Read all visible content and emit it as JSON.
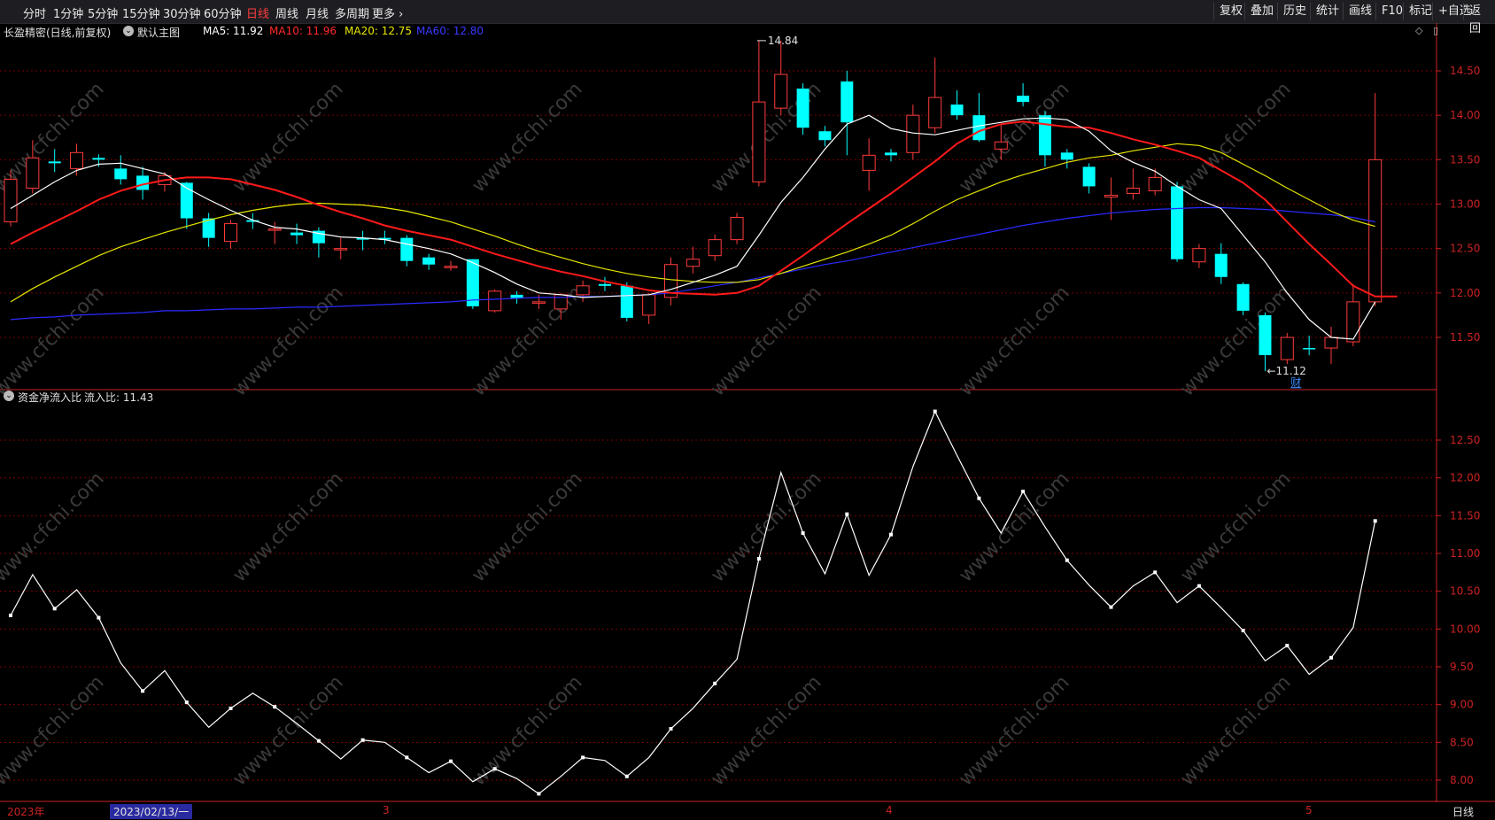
{
  "toolbar": {
    "left_items": [
      "分时",
      "1分钟",
      "5分钟",
      "15分钟",
      "30分钟",
      "60分钟",
      "日线",
      "周线",
      "月线",
      "多周期",
      "更多 ›"
    ],
    "active_index": 6,
    "right_items": [
      "复权",
      "叠加",
      "历史",
      "统计",
      "画线",
      "F10",
      "标记",
      "+自选",
      "返回"
    ]
  },
  "main_info": {
    "stock": "长盈精密(日线,前复权)",
    "indicator": "默认主图",
    "ma5": "MA5: 11.92",
    "ma10": "MA10: 11.96",
    "ma20": "MA20: 12.75",
    "ma60": "MA60: 12.80"
  },
  "sub_info": {
    "name": "资金净流入比",
    "value": "流入比: 11.43"
  },
  "annotations": {
    "high": "14.84",
    "low": "←11.12",
    "cai": "财"
  },
  "price_axis": {
    "ticks": [
      "14.50",
      "14.00",
      "13.50",
      "13.00",
      "12.50",
      "12.00",
      "11.50"
    ]
  },
  "sub_axis": {
    "ticks": [
      "12.50",
      "12.00",
      "11.50",
      "11.00",
      "10.50",
      "10.00",
      "9.50",
      "9.00",
      "8.50",
      "8.00"
    ]
  },
  "bottom_axis": {
    "year_label": "2023年",
    "cursor_date": "2023/02/13/一",
    "month_labels": [
      "3",
      "4",
      "5"
    ],
    "period_label": "日线"
  },
  "watermark": "www.cfchi.com",
  "colors": {
    "up": "#ff3b3b",
    "down": "#00ffff",
    "ma5": "#ffffff",
    "ma10": "#ff1a1a",
    "ma20": "#e6e600",
    "ma60": "#2a2aff",
    "grid": "#7a0000",
    "axis": "#cc2222"
  },
  "chart_data": [
    {
      "type": "candlestick",
      "title": "长盈精密(日线,前复权)",
      "ylim": [
        11.0,
        14.9
      ],
      "candles": [
        [
          12.8,
          13.28,
          13.38,
          12.75
        ],
        [
          13.18,
          13.52,
          13.72,
          13.12
        ],
        [
          13.48,
          13.46,
          13.62,
          13.36
        ],
        [
          13.4,
          13.58,
          13.68,
          13.32
        ],
        [
          13.52,
          13.5,
          13.56,
          13.42
        ],
        [
          13.4,
          13.28,
          13.55,
          13.22
        ],
        [
          13.32,
          13.16,
          13.42,
          13.05
        ],
        [
          13.22,
          13.32,
          13.36,
          13.14
        ],
        [
          13.24,
          12.84,
          13.25,
          12.72
        ],
        [
          12.84,
          12.62,
          12.9,
          12.52
        ],
        [
          12.58,
          12.78,
          12.82,
          12.5
        ],
        [
          12.82,
          12.8,
          12.9,
          12.72
        ],
        [
          12.72,
          12.72,
          12.8,
          12.55
        ],
        [
          12.68,
          12.65,
          12.78,
          12.55
        ],
        [
          12.7,
          12.56,
          12.74,
          12.4
        ],
        [
          12.5,
          12.5,
          12.62,
          12.38
        ],
        [
          12.62,
          12.6,
          12.7,
          12.48
        ],
        [
          12.62,
          12.6,
          12.7,
          12.55
        ],
        [
          12.62,
          12.36,
          12.65,
          12.3
        ],
        [
          12.4,
          12.32,
          12.44,
          12.26
        ],
        [
          12.3,
          12.3,
          12.36,
          12.25
        ],
        [
          12.38,
          11.85,
          12.38,
          11.82
        ],
        [
          11.8,
          12.02,
          12.04,
          11.78
        ],
        [
          11.98,
          11.94,
          12.02,
          11.88
        ],
        [
          11.9,
          11.9,
          11.98,
          11.82
        ],
        [
          11.82,
          11.98,
          12.0,
          11.7
        ],
        [
          11.98,
          12.08,
          12.14,
          11.9
        ],
        [
          12.1,
          12.08,
          12.18,
          12.02
        ],
        [
          12.08,
          11.72,
          12.12,
          11.68
        ],
        [
          11.75,
          11.98,
          12.0,
          11.65
        ],
        [
          11.95,
          12.32,
          12.4,
          11.86
        ],
        [
          12.3,
          12.38,
          12.52,
          12.22
        ],
        [
          12.42,
          12.6,
          12.66,
          12.36
        ],
        [
          12.6,
          12.85,
          12.9,
          12.55
        ],
        [
          13.25,
          14.15,
          14.84,
          13.2
        ],
        [
          14.08,
          14.46,
          14.84,
          14.0
        ],
        [
          14.3,
          13.86,
          14.36,
          13.78
        ],
        [
          13.82,
          13.72,
          13.88,
          13.65
        ],
        [
          14.38,
          13.92,
          14.5,
          13.55
        ],
        [
          13.38,
          13.55,
          13.74,
          13.15
        ],
        [
          13.58,
          13.55,
          13.62,
          13.48
        ],
        [
          13.58,
          14.0,
          14.12,
          13.5
        ],
        [
          13.86,
          14.2,
          14.65,
          13.8
        ],
        [
          14.12,
          14.0,
          14.28,
          13.95
        ],
        [
          14.0,
          13.72,
          14.25,
          13.7
        ],
        [
          13.62,
          13.7,
          13.9,
          13.5
        ],
        [
          14.22,
          14.15,
          14.36,
          14.1
        ],
        [
          14.0,
          13.55,
          14.05,
          13.42
        ],
        [
          13.58,
          13.5,
          13.62,
          13.4
        ],
        [
          13.42,
          13.2,
          13.46,
          13.12
        ],
        [
          13.08,
          13.1,
          13.3,
          12.82
        ],
        [
          13.12,
          13.18,
          13.4,
          13.05
        ],
        [
          13.15,
          13.3,
          13.4,
          13.1
        ],
        [
          13.2,
          12.38,
          13.25,
          12.35
        ],
        [
          12.35,
          12.5,
          12.55,
          12.28
        ],
        [
          12.44,
          12.18,
          12.56,
          12.1
        ],
        [
          12.1,
          11.8,
          12.12,
          11.75
        ],
        [
          11.75,
          11.3,
          11.78,
          11.12
        ],
        [
          11.25,
          11.5,
          11.55,
          11.2
        ],
        [
          11.38,
          11.37,
          11.52,
          11.3
        ],
        [
          11.38,
          11.5,
          11.62,
          11.2
        ],
        [
          11.45,
          11.9,
          12.1,
          11.4
        ],
        [
          11.9,
          13.5,
          14.25,
          11.85
        ]
      ],
      "ma5": [
        12.95,
        13.1,
        13.25,
        13.38,
        13.45,
        13.46,
        13.4,
        13.34,
        13.18,
        13.05,
        12.93,
        12.82,
        12.74,
        12.72,
        12.67,
        12.63,
        12.62,
        12.6,
        12.55,
        12.5,
        12.44,
        12.34,
        12.23,
        12.1,
        12.0,
        11.98,
        11.95,
        11.96,
        11.97,
        11.98,
        12.04,
        12.12,
        12.2,
        12.3,
        12.65,
        13.02,
        13.3,
        13.62,
        13.9,
        14.0,
        13.85,
        13.8,
        13.78,
        13.83,
        13.88,
        13.92,
        13.96,
        13.97,
        13.95,
        13.82,
        13.6,
        13.47,
        13.37,
        13.2,
        13.05,
        12.95,
        12.65,
        12.35,
        12.0,
        11.7,
        11.5,
        11.48,
        11.9
      ],
      "ma10": [
        12.55,
        12.68,
        12.8,
        12.92,
        13.05,
        13.15,
        13.22,
        13.27,
        13.3,
        13.3,
        13.28,
        13.22,
        13.16,
        13.08,
        12.99,
        12.91,
        12.84,
        12.76,
        12.7,
        12.65,
        12.6,
        12.52,
        12.44,
        12.37,
        12.3,
        12.24,
        12.19,
        12.13,
        12.08,
        12.03,
        12.0,
        11.99,
        11.98,
        12.0,
        12.08,
        12.25,
        12.42,
        12.6,
        12.78,
        12.95,
        13.12,
        13.3,
        13.48,
        13.68,
        13.82,
        13.9,
        13.93,
        13.9,
        13.87,
        13.86,
        13.8,
        13.73,
        13.67,
        13.6,
        13.52,
        13.38,
        13.24,
        13.05,
        12.8,
        12.55,
        12.32,
        12.08,
        11.96,
        11.96
      ],
      "ma20": [
        11.9,
        12.05,
        12.18,
        12.3,
        12.42,
        12.52,
        12.6,
        12.68,
        12.75,
        12.82,
        12.88,
        12.93,
        12.97,
        13.0,
        13.01,
        13.0,
        12.99,
        12.96,
        12.92,
        12.86,
        12.8,
        12.72,
        12.64,
        12.55,
        12.47,
        12.4,
        12.33,
        12.27,
        12.22,
        12.18,
        12.15,
        12.13,
        12.12,
        12.12,
        12.15,
        12.22,
        12.3,
        12.38,
        12.46,
        12.55,
        12.65,
        12.78,
        12.92,
        13.05,
        13.15,
        13.25,
        13.33,
        13.4,
        13.47,
        13.52,
        13.55,
        13.6,
        13.64,
        13.68,
        13.66,
        13.58,
        13.45,
        13.32,
        13.18,
        13.05,
        12.92,
        12.82,
        12.75
      ],
      "ma60": [
        11.7,
        11.72,
        11.73,
        11.75,
        11.76,
        11.77,
        11.78,
        11.8,
        11.8,
        11.81,
        11.82,
        11.82,
        11.83,
        11.84,
        11.84,
        11.85,
        11.86,
        11.87,
        11.88,
        11.89,
        11.9,
        11.92,
        11.93,
        11.94,
        11.95,
        11.95,
        11.96,
        11.96,
        11.97,
        11.98,
        12.0,
        12.04,
        12.08,
        12.12,
        12.17,
        12.22,
        12.27,
        12.32,
        12.36,
        12.41,
        12.46,
        12.51,
        12.56,
        12.61,
        12.66,
        12.71,
        12.76,
        12.8,
        12.84,
        12.87,
        12.9,
        12.92,
        12.94,
        12.95,
        12.96,
        12.96,
        12.95,
        12.94,
        12.92,
        12.9,
        12.88,
        12.85,
        12.8
      ]
    },
    {
      "type": "line",
      "title": "资金净流入比",
      "ylim": [
        7.9,
        13.0
      ],
      "values": [
        10.18,
        10.72,
        10.27,
        10.52,
        10.15,
        9.55,
        9.18,
        9.45,
        9.03,
        8.7,
        8.95,
        9.15,
        8.97,
        8.75,
        8.52,
        8.28,
        8.53,
        8.5,
        8.3,
        8.1,
        8.25,
        7.98,
        8.15,
        8.02,
        7.82,
        8.05,
        8.3,
        8.26,
        8.05,
        8.3,
        8.68,
        8.95,
        9.28,
        9.6,
        10.93,
        12.07,
        11.27,
        10.73,
        11.52,
        10.71,
        11.25,
        12.15,
        12.88,
        12.3,
        11.73,
        11.27,
        11.82,
        11.35,
        10.91,
        10.58,
        10.29,
        10.57,
        10.75,
        10.35,
        10.57,
        10.28,
        9.98,
        9.58,
        9.78,
        9.4,
        9.62,
        10.02,
        11.43
      ]
    }
  ]
}
